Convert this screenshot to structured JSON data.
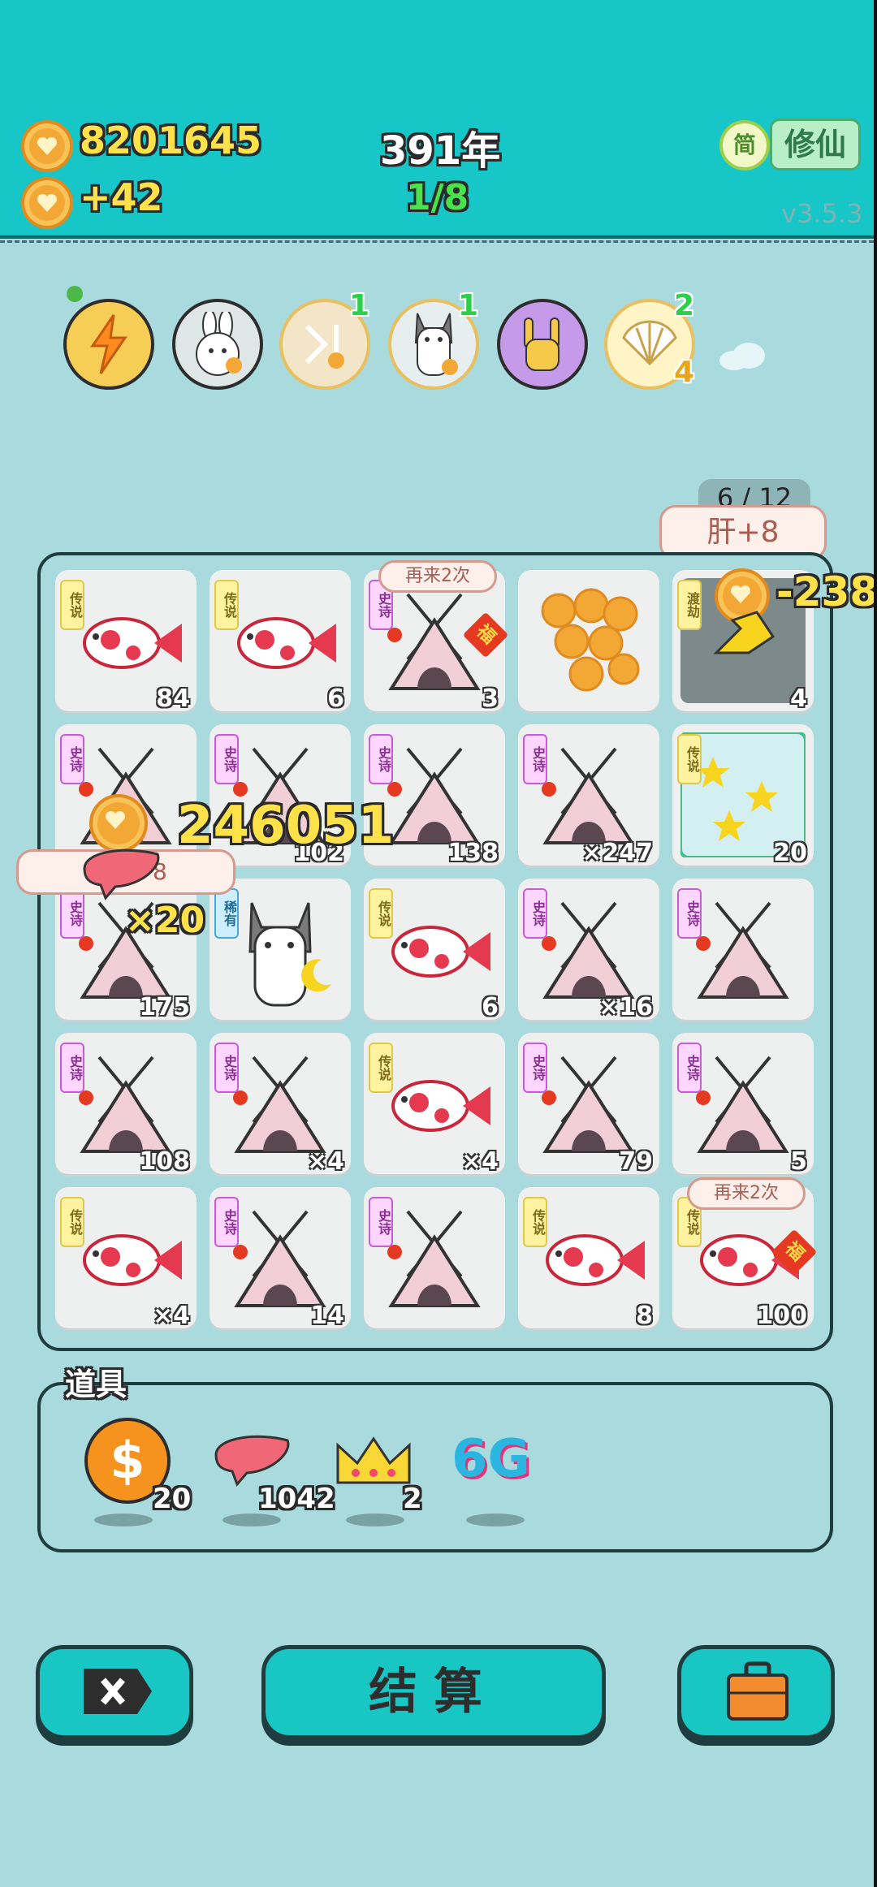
{
  "header": {
    "coins": "8201645",
    "coin_gain": "+42",
    "year": "391年",
    "progress": "1/8",
    "lang_label": "简",
    "mode_label": "修仙",
    "version": "v3.5.3"
  },
  "skills": [
    {
      "name": "lightning",
      "badge": ""
    },
    {
      "name": "rabbit",
      "badge": ""
    },
    {
      "name": "skip",
      "badge": "1"
    },
    {
      "name": "husky",
      "badge": "1"
    },
    {
      "name": "rock-hand",
      "badge": ""
    },
    {
      "name": "shell",
      "badge": "2",
      "badge2": "4"
    }
  ],
  "float": {
    "spin_counter": "6 / 12",
    "liver_bonus": "肝+8",
    "coin_loss": "-238",
    "coin_gain_big": "246051",
    "liver_bonus_left": "+  肝+8",
    "multiplier_left": "×20",
    "retry_label": "再来2次"
  },
  "grid": [
    [
      {
        "tag": "传说",
        "item": "fish",
        "count": "84"
      },
      {
        "tag": "传说",
        "item": "fish",
        "count": "6"
      },
      {
        "tag": "史诗",
        "item": "tent",
        "count": "3",
        "extra": "福",
        "bubble": "再来2次"
      },
      {
        "tag": "",
        "item": "coins",
        "count": ""
      },
      {
        "tag": "渡劫",
        "item": "dark",
        "count": "4"
      }
    ],
    [
      {
        "tag": "史诗",
        "item": "tent",
        "count": ""
      },
      {
        "tag": "史诗",
        "item": "tent",
        "count": "102"
      },
      {
        "tag": "史诗",
        "item": "tent",
        "count": "138"
      },
      {
        "tag": "史诗",
        "item": "tent",
        "count": "×247"
      },
      {
        "tag": "传说",
        "item": "stars",
        "count": "20"
      }
    ],
    [
      {
        "tag": "史诗",
        "item": "tent",
        "count": "175"
      },
      {
        "tag": "稀有",
        "item": "husky",
        "count": ""
      },
      {
        "tag": "传说",
        "item": "fish",
        "count": "6"
      },
      {
        "tag": "史诗",
        "item": "tent",
        "count": "×16"
      },
      {
        "tag": "史诗",
        "item": "tent",
        "count": ""
      }
    ],
    [
      {
        "tag": "史诗",
        "item": "tent",
        "count": "108"
      },
      {
        "tag": "史诗",
        "item": "tent",
        "count": "×4"
      },
      {
        "tag": "传说",
        "item": "fish",
        "count": "×4"
      },
      {
        "tag": "史诗",
        "item": "tent",
        "count": "79"
      },
      {
        "tag": "史诗",
        "item": "tent",
        "count": "5"
      }
    ],
    [
      {
        "tag": "传说",
        "item": "fish",
        "count": "×4"
      },
      {
        "tag": "史诗",
        "item": "tent",
        "count": "14"
      },
      {
        "tag": "史诗",
        "item": "tent",
        "count": ""
      },
      {
        "tag": "传说",
        "item": "fish",
        "count": "8"
      },
      {
        "tag": "传说",
        "item": "fish",
        "count": "100",
        "extra": "福",
        "bubble": "再来2次"
      }
    ]
  ],
  "tools": {
    "title": "道具",
    "items": [
      {
        "name": "dollar-coin",
        "count": "20"
      },
      {
        "name": "liver",
        "count": "1042"
      },
      {
        "name": "crown",
        "count": "2"
      },
      {
        "name": "6g",
        "label": "6G",
        "count": ""
      }
    ]
  },
  "buttons": {
    "settle": "结算"
  },
  "colors": {
    "header": "#17c6c6",
    "background": "#a8dade",
    "button": "#18c6c4"
  }
}
